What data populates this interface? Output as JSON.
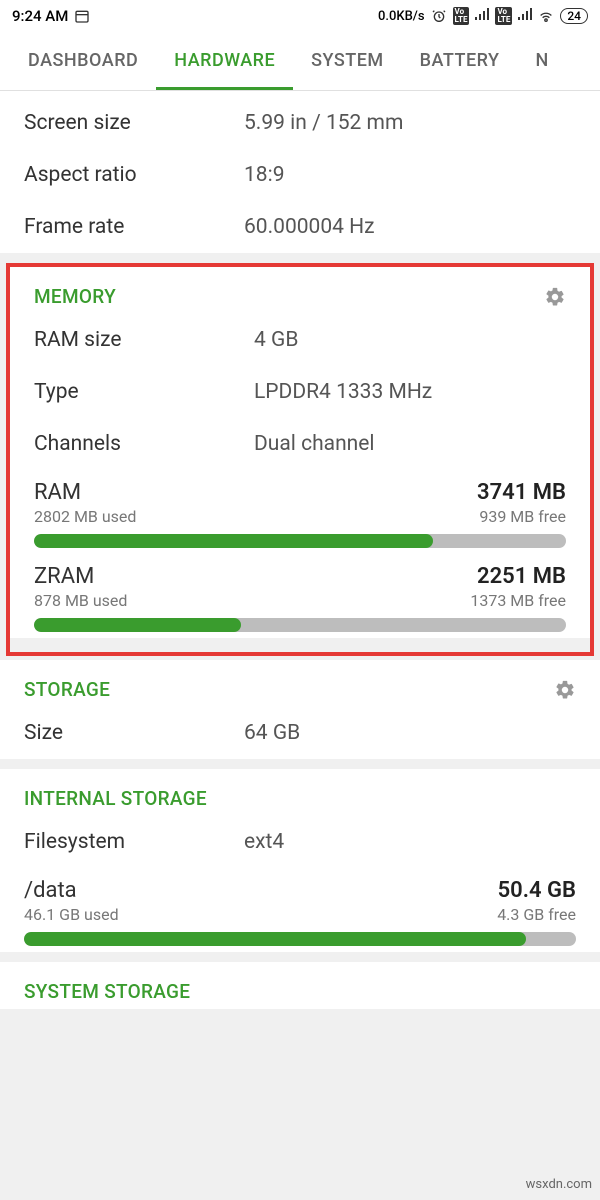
{
  "status": {
    "time": "9:24 AM",
    "net_speed": "0.0KB/s",
    "battery": "24"
  },
  "tabs": {
    "dashboard": "DASHBOARD",
    "hardware": "HARDWARE",
    "system": "SYSTEM",
    "battery": "BATTERY"
  },
  "display": {
    "screen_size_label": "Screen size",
    "screen_size_value": "5.99 in / 152 mm",
    "aspect_ratio_label": "Aspect ratio",
    "aspect_ratio_value": "18:9",
    "frame_rate_label": "Frame rate",
    "frame_rate_value": "60.000004 Hz"
  },
  "memory": {
    "title": "MEMORY",
    "ram_size_label": "RAM size",
    "ram_size_value": "4 GB",
    "type_label": "Type",
    "type_value": "LPDDR4 1333 MHz",
    "channels_label": "Channels",
    "channels_value": "Dual channel",
    "ram": {
      "name": "RAM",
      "total": "3741 MB",
      "used": "2802 MB used",
      "free": "939 MB free",
      "percent": 75
    },
    "zram": {
      "name": "ZRAM",
      "total": "2251 MB",
      "used": "878 MB used",
      "free": "1373 MB free",
      "percent": 39
    }
  },
  "storage": {
    "title": "STORAGE",
    "size_label": "Size",
    "size_value": "64 GB"
  },
  "internal_storage": {
    "title": "INTERNAL STORAGE",
    "fs_label": "Filesystem",
    "fs_value": "ext4",
    "data": {
      "name": "/data",
      "total": "50.4 GB",
      "used": "46.1 GB used",
      "free": "4.3 GB free",
      "percent": 91
    }
  },
  "system_storage": {
    "title": "SYSTEM STORAGE"
  },
  "watermark": "wsxdn.com"
}
